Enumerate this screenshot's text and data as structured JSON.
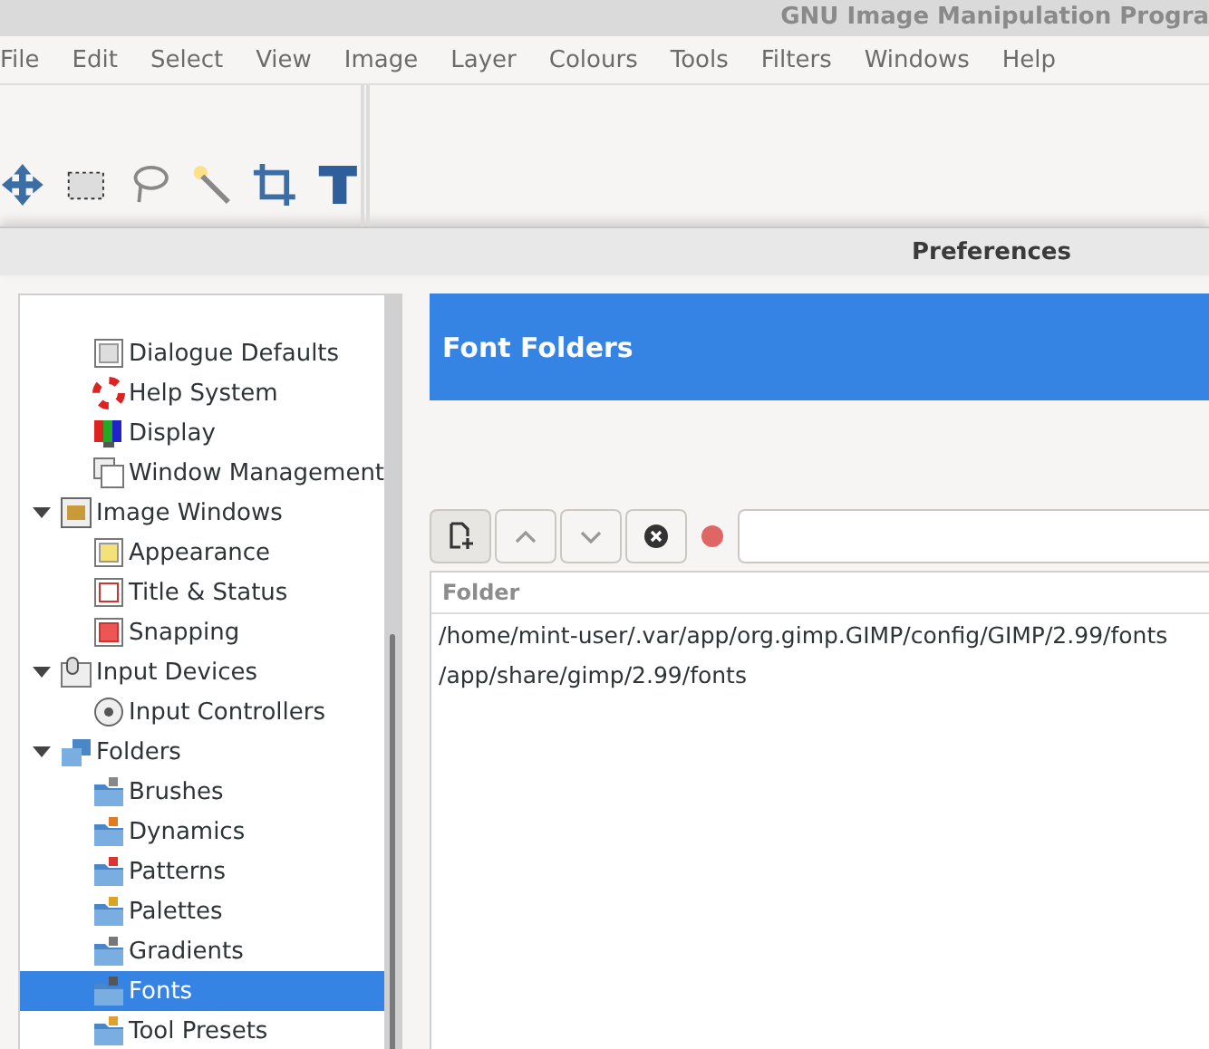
{
  "window": {
    "title": "GNU Image Manipulation Progra"
  },
  "menu": [
    "File",
    "Edit",
    "Select",
    "View",
    "Image",
    "Layer",
    "Colours",
    "Tools",
    "Filters",
    "Windows",
    "Help"
  ],
  "dialog": {
    "title": "Preferences"
  },
  "tree": {
    "partial_children": [
      {
        "label": "Dialogue Defaults",
        "selected": false
      },
      {
        "label": "Help System",
        "selected": false
      },
      {
        "label": "Display",
        "selected": false
      },
      {
        "label": "Window Management",
        "selected": false
      }
    ],
    "items": [
      {
        "label": "Image Windows",
        "selected": false,
        "expanded": true,
        "children": [
          {
            "label": "Appearance",
            "selected": false
          },
          {
            "label": "Title & Status",
            "selected": false
          },
          {
            "label": "Snapping",
            "selected": false
          }
        ]
      },
      {
        "label": "Input Devices",
        "selected": false,
        "expanded": true,
        "children": [
          {
            "label": "Input Controllers",
            "selected": false
          }
        ]
      },
      {
        "label": "Folders",
        "selected": false,
        "expanded": true,
        "children": [
          {
            "label": "Brushes",
            "selected": false
          },
          {
            "label": "Dynamics",
            "selected": false
          },
          {
            "label": "Patterns",
            "selected": false
          },
          {
            "label": "Palettes",
            "selected": false
          },
          {
            "label": "Gradients",
            "selected": false
          },
          {
            "label": "Fonts",
            "selected": true
          },
          {
            "label": "Tool Presets",
            "selected": false
          }
        ]
      }
    ]
  },
  "page": {
    "title": "Font Folders",
    "toolbar": [
      {
        "kind": "new",
        "disabled": false
      },
      {
        "kind": "up",
        "disabled": true
      },
      {
        "kind": "down",
        "disabled": true
      },
      {
        "kind": "delete",
        "disabled": false
      }
    ],
    "list": {
      "column": "Folder",
      "rows": [
        "/home/mint-user/.var/app/org.gimp.GIMP/config/GIMP/2.99/fonts",
        "/app/share/gimp/2.99/fonts"
      ]
    }
  }
}
